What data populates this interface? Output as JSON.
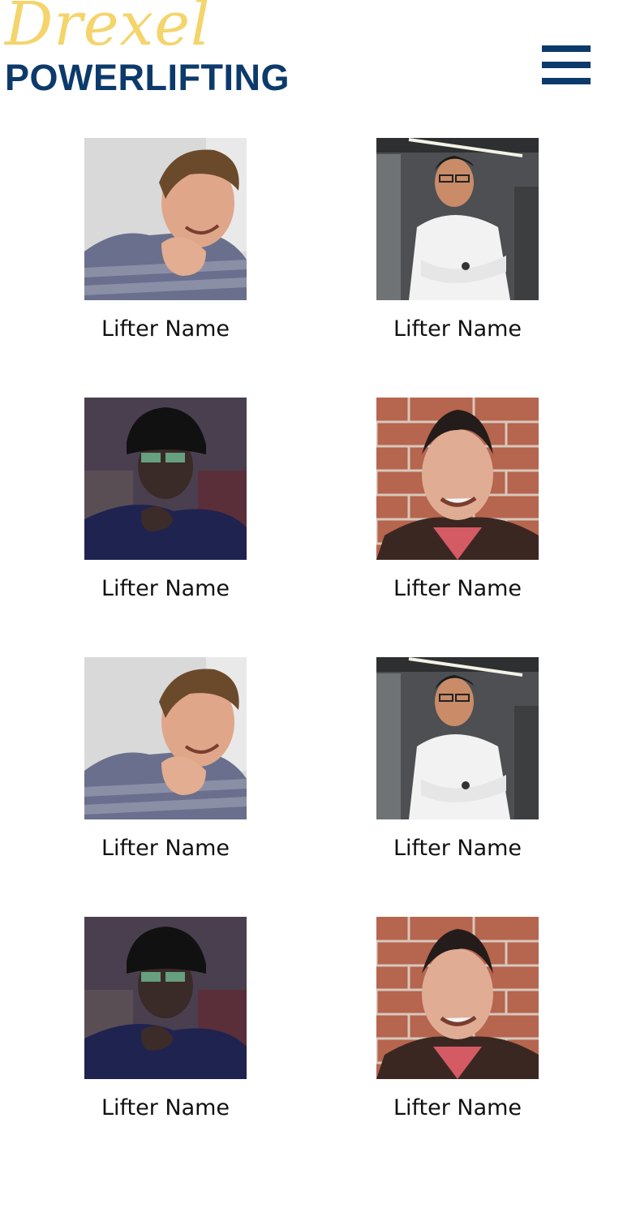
{
  "header": {
    "logo_script": "Drexel",
    "logo_word": "POWERLIFTING",
    "menu_icon": "hamburger-menu-icon"
  },
  "colors": {
    "brand_navy": "#0c3a6b",
    "brand_gold": "#f4d46b"
  },
  "lifters": [
    {
      "name": "Lifter Name",
      "photo": "portrait-smiling-young-man-striped-sweater"
    },
    {
      "name": "Lifter Name",
      "photo": "portrait-man-glasses-white-shirt-arms-crossed"
    },
    {
      "name": "Lifter Name",
      "photo": "portrait-man-black-hat-glasses"
    },
    {
      "name": "Lifter Name",
      "photo": "portrait-man-brick-wall-plaid-shirt"
    },
    {
      "name": "Lifter Name",
      "photo": "portrait-smiling-young-man-striped-sweater"
    },
    {
      "name": "Lifter Name",
      "photo": "portrait-man-glasses-white-shirt-arms-crossed"
    },
    {
      "name": "Lifter Name",
      "photo": "portrait-man-black-hat-glasses"
    },
    {
      "name": "Lifter Name",
      "photo": "portrait-man-brick-wall-plaid-shirt"
    }
  ]
}
